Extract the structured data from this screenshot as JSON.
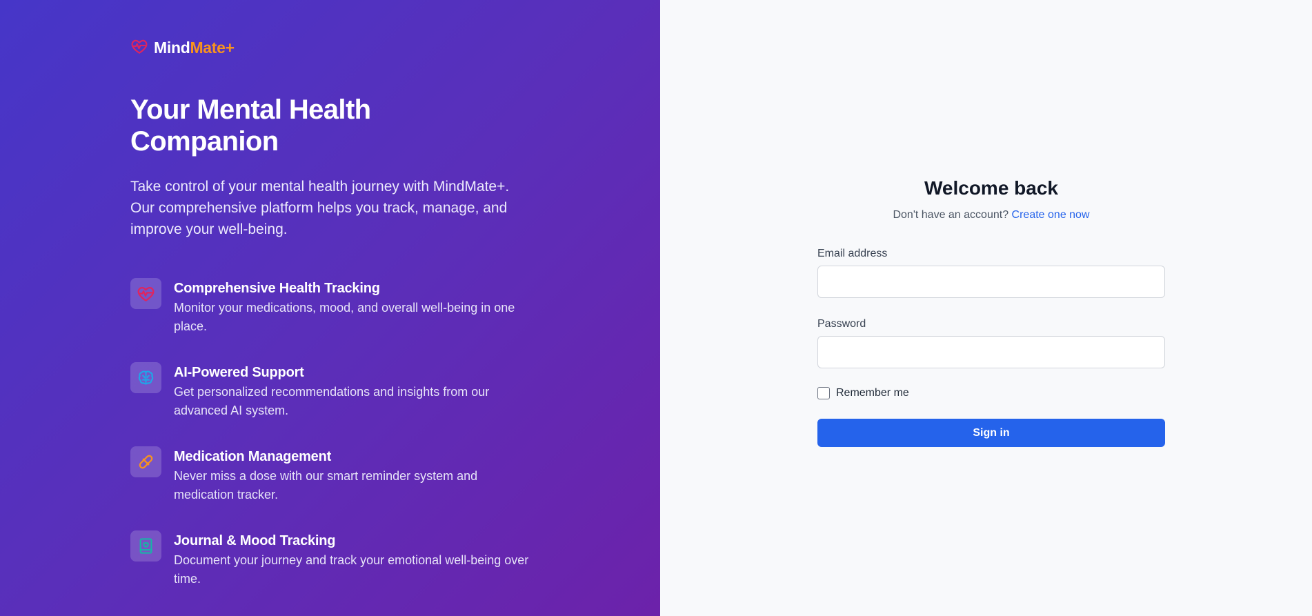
{
  "brand": {
    "name_part1": "Mind",
    "name_part2": "Mate+",
    "accent_color": "#f7931e",
    "icon": "heart-pulse-icon"
  },
  "hero": {
    "headline": "Your Mental Health Companion",
    "intro": "Take control of your mental health journey with MindMate+. Our comprehensive platform helps you track, manage, and improve your well-being."
  },
  "features": [
    {
      "icon": "heart-pulse-icon",
      "title": "Comprehensive Health Tracking",
      "description": "Monitor your medications, mood, and overall well-being in one place."
    },
    {
      "icon": "brain-icon",
      "title": "AI-Powered Support",
      "description": "Get personalized recommendations and insights from our advanced AI system."
    },
    {
      "icon": "pill-icon",
      "title": "Medication Management",
      "description": "Never miss a dose with our smart reminder system and medication tracker."
    },
    {
      "icon": "journal-icon",
      "title": "Journal & Mood Tracking",
      "description": "Document your journey and track your emotional well-being over time."
    }
  ],
  "login": {
    "title": "Welcome back",
    "no_account_text": "Don't have an account?",
    "create_link": "Create one now",
    "email_label": "Email address",
    "email_value": "",
    "password_label": "Password",
    "password_value": "",
    "remember_label": "Remember me",
    "remember_checked": false,
    "signin_label": "Sign in"
  },
  "colors": {
    "primary": "#2563eb",
    "gradient_start": "#4636c8",
    "gradient_end": "#6c22aa",
    "heart": "#e0245e",
    "brain": "#1ea7e8",
    "pill": "#f7931e",
    "journal": "#14b8a6"
  }
}
